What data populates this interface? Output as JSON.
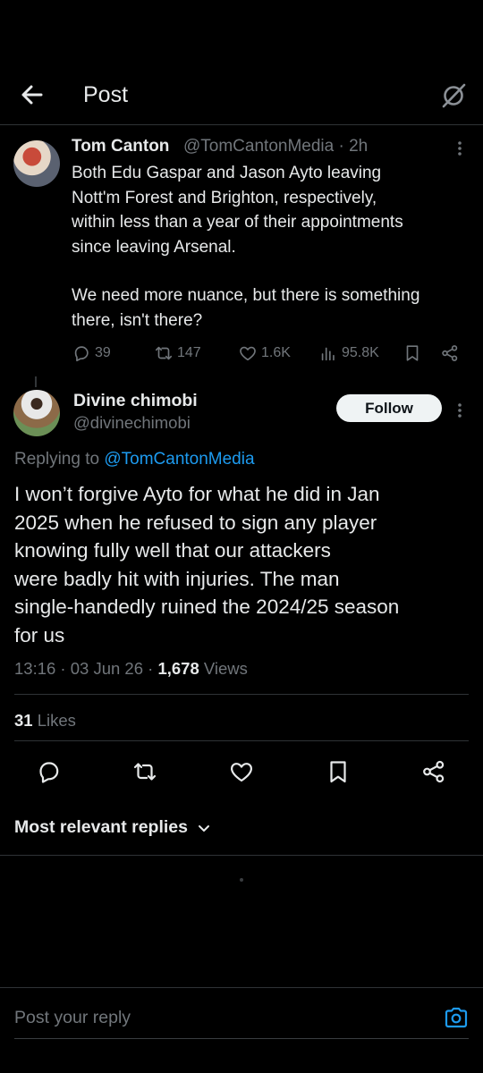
{
  "header": {
    "title": "Post"
  },
  "parent_tweet": {
    "name": "Tom Canton",
    "handle": "@TomCantonMedia · 2h",
    "text_p1": "Both Edu Gaspar and Jason Ayto leaving\nNott'm Forest and Brighton, respectively,\nwithin less than a year of their appointments\nsince leaving Arsenal.",
    "text_p2": "We need more nuance, but there is something\nthere, isn't there?",
    "replies": "39",
    "reposts": "147",
    "likes": "1.6K",
    "views": "95.8K"
  },
  "main_tweet": {
    "name": "Divine chimobi",
    "handle": "@divinechimobi",
    "follow_label": "Follow",
    "replying_prefix": "Replying to ",
    "replying_mention": "@TomCantonMedia",
    "text": "I won’t forgive Ayto for what he did in Jan\n2025 when he refused to sign any player\nknowing fully well that our attackers\nwere badly hit with injuries. The man\nsingle-handedly ruined the 2024/25 season\nfor us",
    "timestamp": "13:16 · 03 Jun 26 · ",
    "views_count": "1,678",
    "views_label": " Views",
    "likes_count": "31",
    "likes_label": " Likes"
  },
  "replies_filter": "Most relevant replies",
  "reply_bar": {
    "placeholder": "Post your reply"
  },
  "colors": {
    "accent": "#1d9bf0",
    "background": "#000000",
    "muted": "#71767b",
    "text": "#e7e9ea"
  },
  "icons": [
    "back-arrow-icon",
    "grok-icon",
    "more-icon",
    "reply-icon",
    "repost-icon",
    "like-icon",
    "views-icon",
    "bookmark-icon",
    "share-icon",
    "chevron-down-icon",
    "camera-icon"
  ]
}
